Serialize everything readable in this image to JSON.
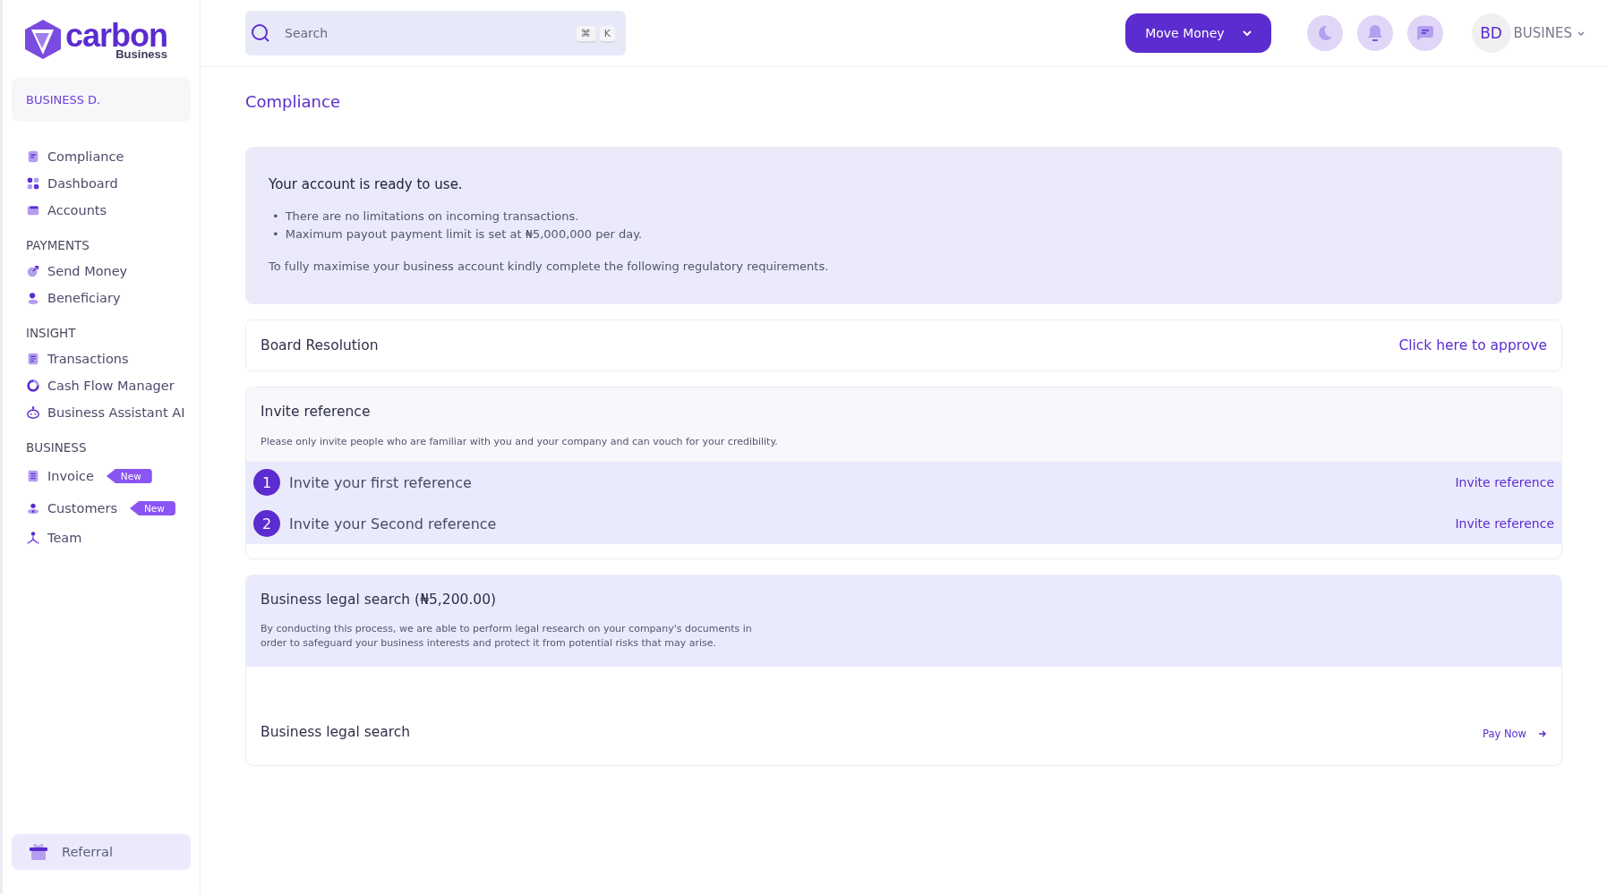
{
  "brand": {
    "name": "carbon",
    "sub": "Business"
  },
  "sidebar": {
    "account": "BUSINESS D.",
    "sections": [
      {
        "items": [
          {
            "label": "Compliance",
            "selected": false
          },
          {
            "label": "Dashboard",
            "selected": false
          },
          {
            "label": "Accounts",
            "selected": false
          }
        ]
      },
      {
        "heading": "PAYMENTS",
        "items": [
          {
            "label": "Send Money",
            "selected": false
          },
          {
            "label": "Beneficiary",
            "selected": false
          }
        ]
      },
      {
        "heading": "INSIGHT",
        "items": [
          {
            "label": "Transactions",
            "selected": false
          },
          {
            "label": "Cash Flow Manager",
            "selected": false
          },
          {
            "label": "Business Assistant AI",
            "selected": false
          }
        ]
      },
      {
        "heading": "BUSINESS",
        "items": [
          {
            "label": "Invoice",
            "selected": false,
            "badge": "New"
          },
          {
            "label": "Customers",
            "selected": false,
            "badge": "New"
          },
          {
            "label": "Team",
            "selected": false
          }
        ]
      }
    ],
    "referral": "Referral"
  },
  "header": {
    "search": {
      "placeholder": "Search",
      "keys": [
        "⌘",
        "K"
      ]
    },
    "move_money": "Move Money",
    "avatar": "BD",
    "user_name": "BUSINES"
  },
  "page_title": "Compliance",
  "info_card": {
    "title": "Your account is ready to use.",
    "bullet_marker": "•",
    "bullets": [
      "There are no limitations on incoming transactions.",
      "Maximum payout payment limit is set at ₦5,000,000 per day."
    ],
    "note": "To fully maximise your business account kindly complete the following regulatory requirements."
  },
  "board_resolution": {
    "title": "Board Resolution",
    "action": "Click here to approve"
  },
  "invite_reference": {
    "title": "Invite reference",
    "description": "Please only invite people who are familiar with you and your company and can vouch for your credibility.",
    "steps": [
      {
        "number": "1",
        "label": "Invite your first reference",
        "action": "Invite reference"
      },
      {
        "number": "2",
        "label": "Invite your Second reference",
        "action": "Invite reference"
      }
    ]
  },
  "legal_search": {
    "title": "Business legal search (₦5,200.00)",
    "description": "By conducting this process, we are able to perform legal research on your company's documents in order to safeguard your business interests and protect it from potential risks that may arise.",
    "item": "Business legal search",
    "action": "Pay Now"
  }
}
